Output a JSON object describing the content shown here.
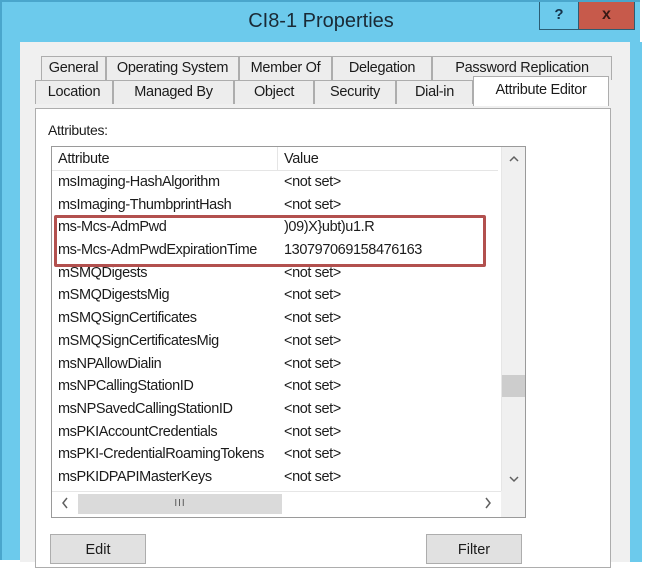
{
  "window": {
    "title": "CI8-1 Properties",
    "help_label": "?",
    "close_label": "x"
  },
  "tabs": {
    "row1": [
      {
        "label": "General"
      },
      {
        "label": "Operating System"
      },
      {
        "label": "Member Of"
      },
      {
        "label": "Delegation"
      },
      {
        "label": "Password Replication"
      }
    ],
    "row2": [
      {
        "label": "Location"
      },
      {
        "label": "Managed By"
      },
      {
        "label": "Object"
      },
      {
        "label": "Security"
      },
      {
        "label": "Dial-in"
      },
      {
        "label": "Attribute Editor",
        "active": true
      }
    ]
  },
  "attribute_editor": {
    "attributes_label": "Attributes:",
    "columns": {
      "attribute": "Attribute",
      "value": "Value"
    },
    "rows": [
      {
        "attribute": "msImaging-HashAlgorithm",
        "value": "<not set>"
      },
      {
        "attribute": "msImaging-ThumbprintHash",
        "value": "<not set>"
      },
      {
        "attribute": "ms-Mcs-AdmPwd",
        "value": ")09)X}ubt)u1.R",
        "highlighted": true
      },
      {
        "attribute": "ms-Mcs-AdmPwdExpirationTime",
        "value": "130797069158476163",
        "highlighted": true
      },
      {
        "attribute": "mSMQDigests",
        "value": "<not set>"
      },
      {
        "attribute": "mSMQDigestsMig",
        "value": "<not set>"
      },
      {
        "attribute": "mSMQSignCertificates",
        "value": "<not set>"
      },
      {
        "attribute": "mSMQSignCertificatesMig",
        "value": "<not set>"
      },
      {
        "attribute": "msNPAllowDialin",
        "value": "<not set>"
      },
      {
        "attribute": "msNPCallingStationID",
        "value": "<not set>"
      },
      {
        "attribute": "msNPSavedCallingStationID",
        "value": "<not set>"
      },
      {
        "attribute": "msPKIAccountCredentials",
        "value": "<not set>"
      },
      {
        "attribute": "msPKI-CredentialRoamingTokens",
        "value": "<not set>"
      },
      {
        "attribute": "msPKIDPAPIMasterKeys",
        "value": "<not set>"
      }
    ],
    "scrollbar": {
      "up_icon": "chevron-up",
      "down_icon": "chevron-down",
      "left_icon": "chevron-left",
      "right_icon": "chevron-right",
      "grip_glyph": "III"
    },
    "buttons": {
      "edit": "Edit",
      "filter": "Filter"
    }
  },
  "colors": {
    "title_bar": "#6ccaec",
    "close_button": "#c75a4b",
    "highlight_box": "#b2504e"
  }
}
